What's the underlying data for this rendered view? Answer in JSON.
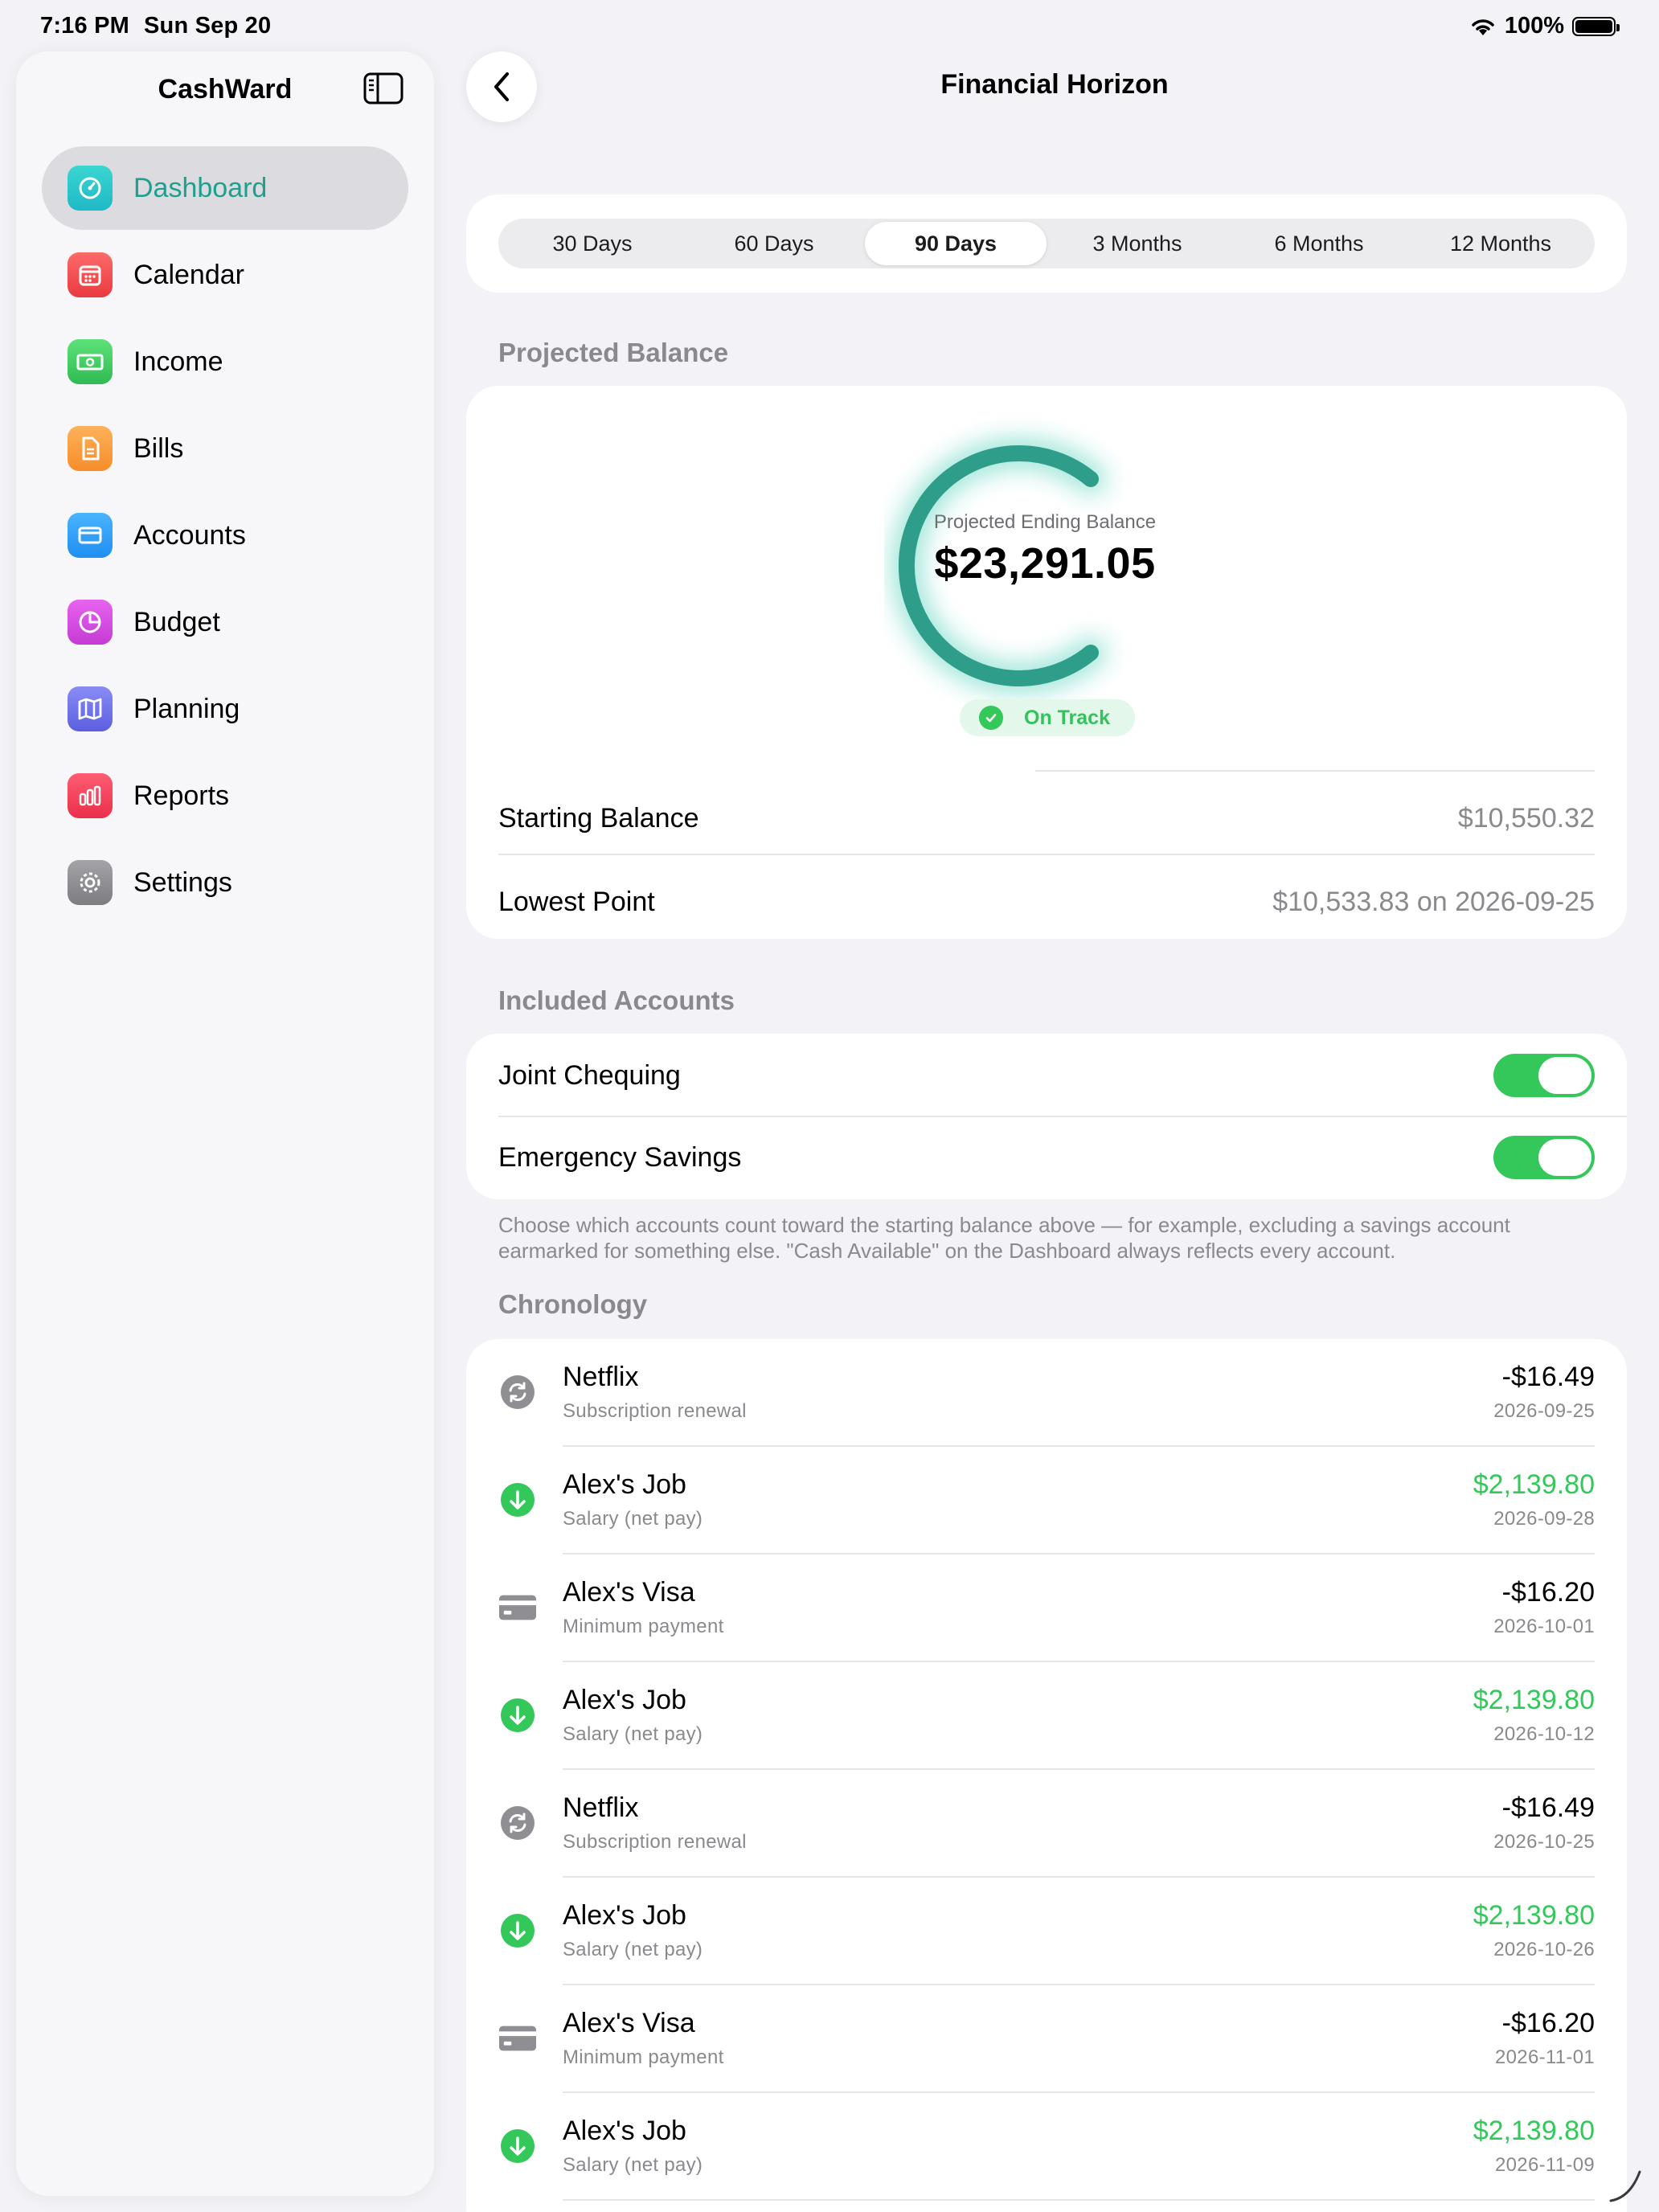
{
  "status_bar": {
    "time": "7:16 PM",
    "date": "Sun Sep 20",
    "battery": "100%"
  },
  "sidebar": {
    "title": "CashWard",
    "items": [
      {
        "label": "Dashboard",
        "icon": "dashboard-icon",
        "color": "#2ec8c8",
        "active": true
      },
      {
        "label": "Calendar",
        "icon": "calendar-icon",
        "color": "#f0464b"
      },
      {
        "label": "Income",
        "icon": "banknote-icon",
        "color": "#3dc85c"
      },
      {
        "label": "Bills",
        "icon": "document-icon",
        "color": "#fa9a38"
      },
      {
        "label": "Accounts",
        "icon": "credit-card-icon",
        "color": "#2e9bf2"
      },
      {
        "label": "Budget",
        "icon": "pie-chart-icon",
        "color": "#d64ddf"
      },
      {
        "label": "Planning",
        "icon": "map-icon",
        "color": "#6b6ee8"
      },
      {
        "label": "Reports",
        "icon": "bar-chart-icon",
        "color": "#f23b55"
      },
      {
        "label": "Settings",
        "icon": "gear-icon",
        "color": "#8e8e93"
      }
    ]
  },
  "header": {
    "title": "Financial Horizon"
  },
  "ranges": {
    "options": [
      "30 Days",
      "60 Days",
      "90 Days",
      "3 Months",
      "6 Months",
      "12 Months"
    ],
    "selected": "90 Days"
  },
  "projected": {
    "section_label": "Projected Balance",
    "ring_label": "Projected Ending Balance",
    "ending_balance": "$23,291.05",
    "status": "On Track",
    "accent": "#2e9e8a",
    "starting_label": "Starting Balance",
    "starting_value": "$10,550.32",
    "lowest_label": "Lowest Point",
    "lowest_value": "$10,533.83 on 2026-09-25"
  },
  "accounts": {
    "section_label": "Included Accounts",
    "items": [
      {
        "name": "Joint Chequing",
        "included": true
      },
      {
        "name": "Emergency Savings",
        "included": true
      }
    ],
    "footnote": "Choose which accounts count toward the starting balance above — for example, excluding a savings account earmarked for something else. \"Cash Available\" on the Dashboard always reflects every account."
  },
  "chronology": {
    "section_label": "Chronology",
    "items": [
      {
        "name": "Netflix",
        "sub": "Subscription renewal",
        "amount": "-$16.49",
        "date": "2026-09-25",
        "kind": "subscription"
      },
      {
        "name": "Alex's Job",
        "sub": "Salary (net pay)",
        "amount": "$2,139.80",
        "date": "2026-09-28",
        "kind": "income"
      },
      {
        "name": "Alex's Visa",
        "sub": "Minimum payment",
        "amount": "-$16.20",
        "date": "2026-10-01",
        "kind": "card"
      },
      {
        "name": "Alex's Job",
        "sub": "Salary (net pay)",
        "amount": "$2,139.80",
        "date": "2026-10-12",
        "kind": "income"
      },
      {
        "name": "Netflix",
        "sub": "Subscription renewal",
        "amount": "-$16.49",
        "date": "2026-10-25",
        "kind": "subscription"
      },
      {
        "name": "Alex's Job",
        "sub": "Salary (net pay)",
        "amount": "$2,139.80",
        "date": "2026-10-26",
        "kind": "income"
      },
      {
        "name": "Alex's Visa",
        "sub": "Minimum payment",
        "amount": "-$16.20",
        "date": "2026-11-01",
        "kind": "card"
      },
      {
        "name": "Alex's Job",
        "sub": "Salary (net pay)",
        "amount": "$2,139.80",
        "date": "2026-11-09",
        "kind": "income"
      }
    ]
  }
}
